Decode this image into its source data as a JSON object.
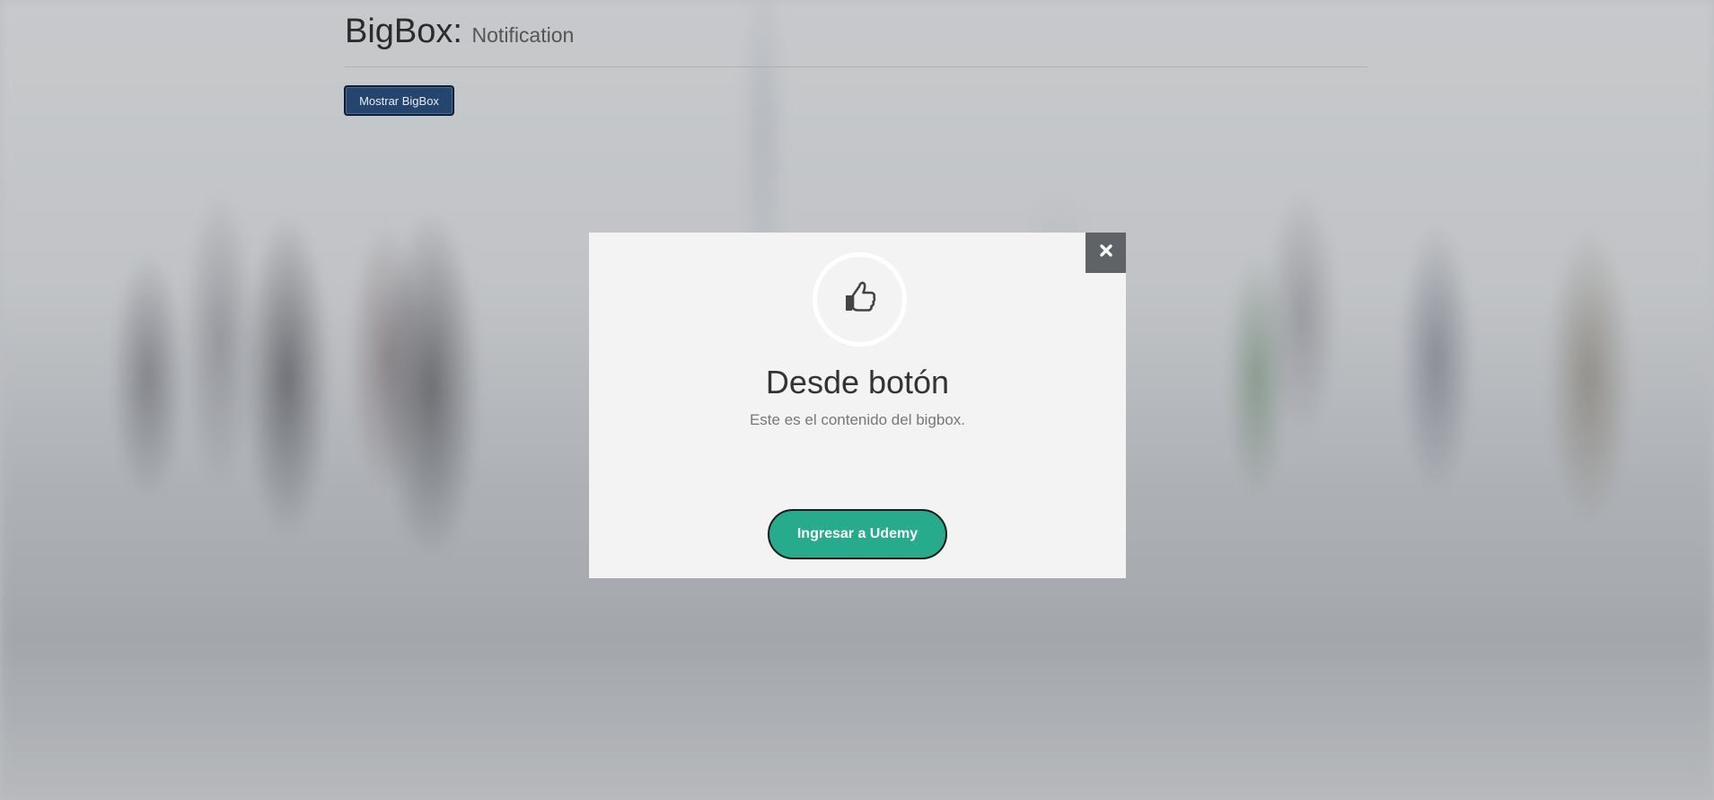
{
  "header": {
    "title": "BigBox:",
    "subtitle": "Notification"
  },
  "toolbar": {
    "show_label": "Mostrar BigBox"
  },
  "modal": {
    "icon": "thumbs-up-icon",
    "close_icon": "close-icon",
    "title": "Desde botón",
    "content": "Este es el contenido del bigbox.",
    "button_label": "Ingresar a Udemy"
  },
  "colors": {
    "show_button_bg": "#24456e",
    "modal_bg": "#f3f3f3",
    "close_bg": "#5f6267",
    "cta_bg": "#26ab8c"
  }
}
